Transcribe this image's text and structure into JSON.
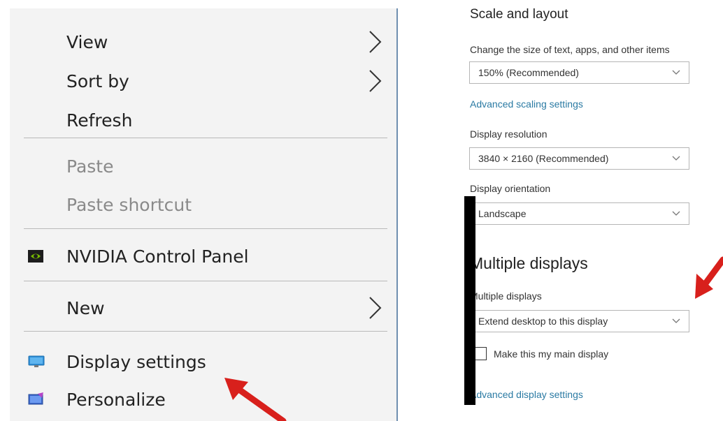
{
  "context_menu": {
    "items": [
      {
        "label": "View",
        "has_submenu": true,
        "disabled": false
      },
      {
        "label": "Sort by",
        "has_submenu": true,
        "disabled": false
      },
      {
        "label": "Refresh",
        "has_submenu": false,
        "disabled": false
      },
      {
        "label": "Paste",
        "has_submenu": false,
        "disabled": true
      },
      {
        "label": "Paste shortcut",
        "has_submenu": false,
        "disabled": true
      },
      {
        "label": "NVIDIA Control Panel",
        "has_submenu": false,
        "disabled": false,
        "icon": "nvidia-icon"
      },
      {
        "label": "New",
        "has_submenu": true,
        "disabled": false
      },
      {
        "label": "Display settings",
        "has_submenu": false,
        "disabled": false,
        "icon": "monitor-icon"
      },
      {
        "label": "Personalize",
        "has_submenu": false,
        "disabled": false,
        "icon": "personalize-icon"
      }
    ]
  },
  "settings": {
    "scale_heading": "Scale and layout",
    "scale_label": "Change the size of text, apps, and other items",
    "scale_value": "150% (Recommended)",
    "advanced_scaling_link": "Advanced scaling settings",
    "resolution_label": "Display resolution",
    "resolution_value": "3840 × 2160 (Recommended)",
    "orientation_label": "Display orientation",
    "orientation_value": "Landscape",
    "multiple_heading": "Multiple displays",
    "multiple_label": "Multiple displays",
    "multiple_value": "Extend desktop to this display",
    "main_display_checkbox_label": "Make this my main display",
    "main_display_checked": false,
    "advanced_display_link": "Advanced display settings"
  },
  "colors": {
    "menu_background": "#f3f3f3",
    "link": "#2a7aa3",
    "annotation_arrow": "#d8201c",
    "nvidia_green": "#76b900"
  }
}
